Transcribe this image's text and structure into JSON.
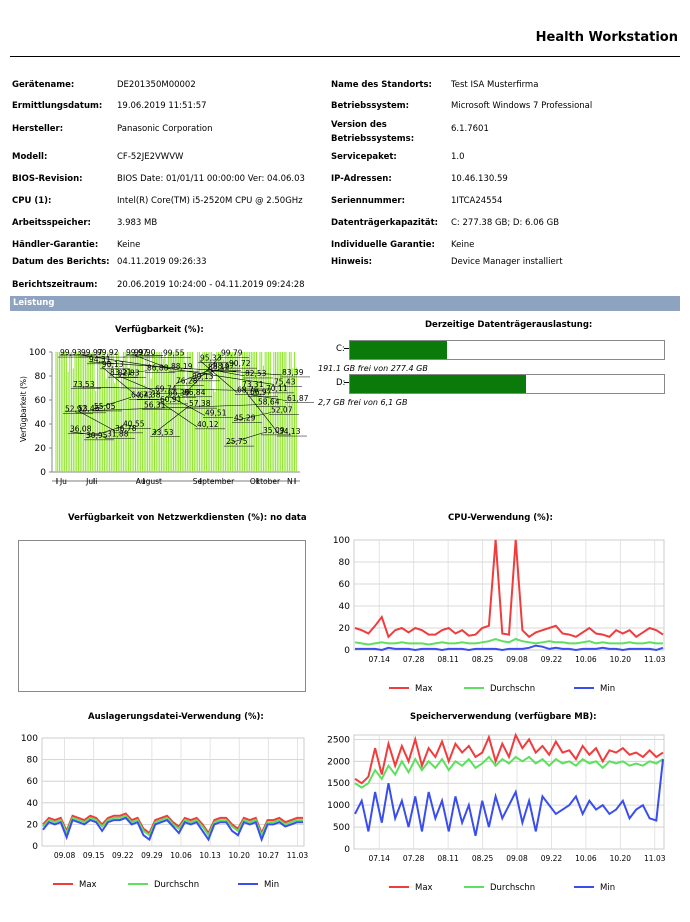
{
  "header": {
    "title": "Health Workstation"
  },
  "info_left": [
    {
      "label": "Gerätename:",
      "value": "DE201350M00002"
    },
    {
      "label": "Ermittlungsdatum:",
      "value": "19.06.2019 11:51:57"
    },
    {
      "label": "Hersteller:",
      "value": "Panasonic Corporation"
    },
    {
      "label": "Modell:",
      "value": "CF-52JE2VWVW"
    },
    {
      "label": "BIOS-Revision:",
      "value": "BIOS Date: 01/01/11 00:00:00 Ver: 04.06.03"
    },
    {
      "label": "CPU (1):",
      "value": "Intel(R) Core(TM) i5-2520M CPU @ 2.50GHz"
    },
    {
      "label": "Arbeitsspeicher:",
      "value": "3.983 MB"
    },
    {
      "label": "Händler-Garantie:",
      "value": "Keine"
    },
    {
      "label": "Datum des Berichts:",
      "value": "04.11.2019 09:26:33"
    },
    {
      "label": "Berichtszeitraum:",
      "value": "20.06.2019 10:24:00 - 04.11.2019 09:24:28"
    }
  ],
  "info_right": [
    {
      "label": "Name des Standorts:",
      "value": "Test ISA Musterfirma"
    },
    {
      "label": "Betriebssystem:",
      "value": "Microsoft Windows 7 Professional"
    },
    {
      "label": "Version des Betriebssystems:",
      "value": "6.1.7601"
    },
    {
      "label": "Servicepaket:",
      "value": "1.0"
    },
    {
      "label": "IP-Adressen:",
      "value": "10.46.130.59"
    },
    {
      "label": "Seriennummer:",
      "value": "1ITCA24554"
    },
    {
      "label": "Datenträgerkapazität:",
      "value": "C: 277.38 GB; D: 6.06 GB"
    },
    {
      "label": "Individuelle Garantie:",
      "value": "Keine"
    },
    {
      "label": "Hinweis:",
      "value": "Device Manager installiert"
    }
  ],
  "section": {
    "title": "Leistung"
  },
  "disk": {
    "title": "Derzeitige Datenträgerauslastung:",
    "drives": [
      {
        "label": "C:",
        "used_fraction": 0.31,
        "note": "191.1 GB frei von 277.4 GB"
      },
      {
        "label": "D:",
        "used_fraction": 0.56,
        "note": "2,7 GB frei von 6,1 GB"
      }
    ],
    "fill_color": "#0a7a0a"
  },
  "network": {
    "title": "Verfügbarkeit von Netzwerkdiensten (%): no data"
  },
  "legend": {
    "max": "Max",
    "avg": "Durchschn",
    "min": "Min",
    "colors": {
      "max": "#f03c3c",
      "avg": "#5ee05e",
      "min": "#3a4ef0"
    }
  },
  "chart_data": [
    {
      "type": "bar",
      "title": "Verfügbarkeit (%):",
      "ylabel": "Verfügbarkeit (%)",
      "ylim": [
        0,
        100
      ],
      "yticks": [
        0,
        20,
        40,
        60,
        80,
        100
      ],
      "xticklabels": [
        "Ju",
        "Juli",
        "August",
        "September",
        "Oktober",
        "N"
      ],
      "annotations": [
        "99,93",
        "99,92",
        "99,90",
        "88,19",
        "88,12",
        "82,53",
        "83,39",
        "94,31",
        "99,97",
        "99,55",
        "95,33",
        "68,76",
        "75,43",
        "99,97",
        "82,83",
        "69,74",
        "80,13",
        "90,72",
        "70,11",
        "73,53",
        "83,21",
        "86,88",
        "66,84",
        "99,79",
        "58,64",
        "52,92",
        "90,13",
        "64,38",
        "76,28",
        "88,67",
        "66,97",
        "61,87",
        "55,05",
        "64,73",
        "66,39",
        "49,51",
        "73,31",
        "34,13",
        "30,95",
        "40,55",
        "60,91",
        "40,12",
        "45,29",
        "52,07",
        "53,46",
        "36,78",
        "33,53",
        "57,38",
        "25,75",
        "35,09",
        "36,08",
        "31,88",
        "56,31"
      ],
      "bar_color": "#8de52a"
    },
    {
      "type": "line",
      "title": "CPU-Verwendung (%):",
      "ylim": [
        0,
        100
      ],
      "yticks": [
        0,
        20,
        40,
        60,
        80,
        100
      ],
      "xticklabels": [
        "07.14",
        "07.28",
        "08.11",
        "08.25",
        "09.08",
        "09.22",
        "10.06",
        "10.20",
        "11.03"
      ],
      "series": [
        {
          "name": "Max",
          "values": [
            20,
            18,
            15,
            22,
            30,
            12,
            18,
            20,
            16,
            20,
            18,
            14,
            14,
            18,
            20,
            15,
            18,
            13,
            14,
            20,
            22,
            100,
            15,
            14,
            100,
            18,
            12,
            16,
            18,
            20,
            22,
            15,
            14,
            12,
            16,
            20,
            15,
            14,
            12,
            18,
            15,
            18,
            12,
            16,
            20,
            18,
            14
          ]
        },
        {
          "name": "Durchschn",
          "values": [
            7,
            6,
            5,
            6,
            7,
            6,
            6,
            7,
            6,
            6,
            6,
            5,
            6,
            7,
            6,
            6,
            7,
            6,
            6,
            7,
            8,
            10,
            8,
            7,
            10,
            8,
            7,
            6,
            7,
            8,
            7,
            7,
            6,
            6,
            7,
            8,
            6,
            7,
            6,
            6,
            6,
            7,
            6,
            6,
            7,
            6,
            6
          ]
        },
        {
          "name": "Min",
          "values": [
            1,
            1,
            1,
            1,
            0,
            2,
            1,
            1,
            1,
            0,
            1,
            1,
            1,
            0,
            1,
            1,
            1,
            0,
            1,
            1,
            1,
            1,
            0,
            1,
            1,
            1,
            2,
            4,
            3,
            1,
            2,
            1,
            1,
            0,
            1,
            1,
            1,
            2,
            1,
            1,
            0,
            1,
            1,
            1,
            1,
            0,
            2
          ]
        }
      ]
    },
    {
      "type": "line",
      "title": "Auslagerungsdatei-Verwendung (%):",
      "ylim": [
        0,
        100
      ],
      "yticks": [
        0,
        20,
        40,
        60,
        80,
        100
      ],
      "xticklabels": [
        "09.08",
        "09.15",
        "09.22",
        "09.29",
        "10.06",
        "10.13",
        "10.20",
        "10.27",
        "11.03"
      ],
      "series": [
        {
          "name": "Max",
          "values": [
            20,
            26,
            24,
            26,
            14,
            28,
            26,
            24,
            28,
            26,
            20,
            26,
            28,
            28,
            30,
            24,
            26,
            16,
            12,
            24,
            26,
            28,
            22,
            18,
            26,
            24,
            26,
            20,
            12,
            24,
            26,
            26,
            20,
            16,
            26,
            24,
            26,
            12,
            24,
            24,
            26,
            22,
            24,
            26,
            26
          ]
        },
        {
          "name": "Durchschn",
          "values": [
            18,
            24,
            22,
            24,
            12,
            26,
            24,
            22,
            26,
            24,
            18,
            24,
            26,
            26,
            28,
            22,
            24,
            14,
            10,
            22,
            24,
            26,
            20,
            16,
            24,
            22,
            24,
            18,
            10,
            22,
            24,
            24,
            18,
            14,
            24,
            22,
            24,
            10,
            22,
            22,
            24,
            20,
            22,
            24,
            24
          ]
        },
        {
          "name": "Min",
          "values": [
            15,
            22,
            20,
            22,
            8,
            24,
            22,
            20,
            24,
            22,
            14,
            22,
            24,
            24,
            26,
            20,
            22,
            10,
            6,
            20,
            22,
            24,
            18,
            12,
            22,
            20,
            22,
            14,
            6,
            20,
            22,
            22,
            14,
            10,
            22,
            20,
            22,
            6,
            20,
            20,
            22,
            18,
            20,
            22,
            22
          ]
        }
      ]
    },
    {
      "type": "line",
      "title": "Speicherverwendung (verfügbare MB):",
      "ylim": [
        0,
        2600
      ],
      "yticks": [
        0,
        500,
        1000,
        1500,
        2000,
        2500
      ],
      "xticklabels": [
        "07.14",
        "07.28",
        "08.11",
        "08.25",
        "09.08",
        "09.22",
        "10.06",
        "10.20",
        "11.03"
      ],
      "series": [
        {
          "name": "Max",
          "values": [
            1600,
            1500,
            1650,
            2300,
            1700,
            2400,
            1900,
            2350,
            2000,
            2500,
            1900,
            2300,
            2100,
            2450,
            2000,
            2400,
            2200,
            2350,
            2100,
            2200,
            2550,
            2000,
            2400,
            2100,
            2600,
            2300,
            2500,
            2200,
            2350,
            2150,
            2450,
            2200,
            2250,
            2050,
            2350,
            2150,
            2300,
            2000,
            2250,
            2200,
            2300,
            2150,
            2200,
            2100,
            2250,
            2100,
            2200
          ]
        },
        {
          "name": "Durchschn",
          "values": [
            1500,
            1400,
            1500,
            1800,
            1600,
            1900,
            1700,
            2000,
            1750,
            2050,
            1800,
            2000,
            1850,
            2050,
            1800,
            2000,
            1900,
            2050,
            1850,
            1950,
            2100,
            1900,
            2050,
            1950,
            2100,
            2000,
            2100,
            1950,
            2050,
            1900,
            2050,
            1950,
            2000,
            1900,
            2050,
            1950,
            2000,
            1850,
            2000,
            1950,
            2000,
            1900,
            1950,
            1900,
            2000,
            1950,
            2050
          ]
        },
        {
          "name": "Min",
          "values": [
            800,
            1100,
            400,
            1300,
            600,
            1500,
            700,
            1100,
            500,
            1200,
            400,
            1300,
            700,
            1100,
            400,
            1200,
            600,
            1000,
            300,
            1100,
            500,
            1200,
            700,
            1000,
            1300,
            600,
            1100,
            400,
            1200,
            1000,
            800,
            900,
            1000,
            1200,
            800,
            1100,
            900,
            1000,
            800,
            900,
            1100,
            700,
            900,
            1000,
            700,
            650,
            2050
          ]
        }
      ]
    }
  ]
}
